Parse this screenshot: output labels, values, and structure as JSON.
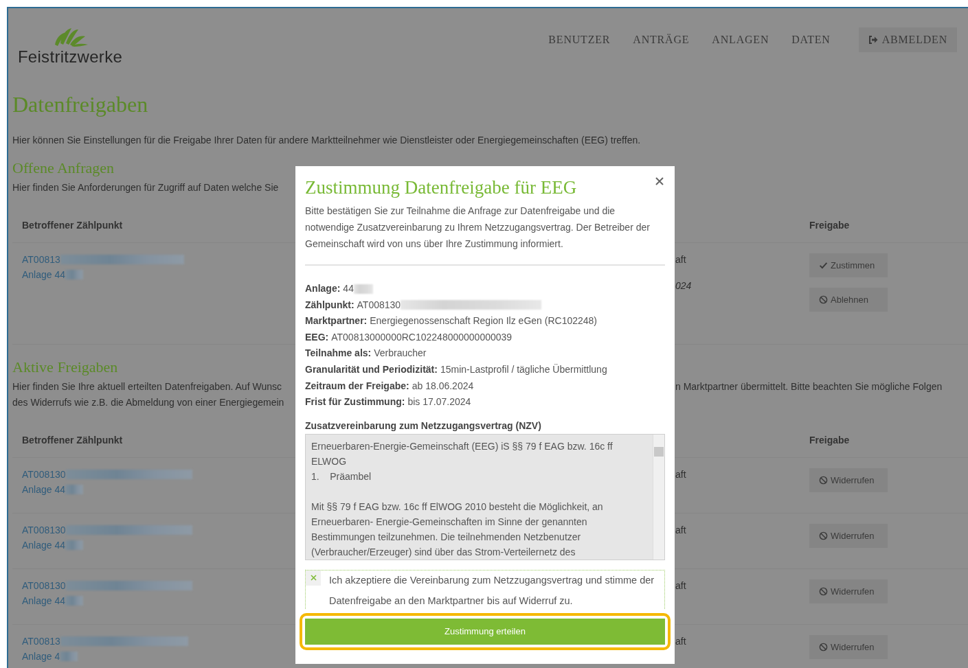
{
  "header": {
    "logo_text": "Feistritzwerke",
    "nav": [
      "BENUTZER",
      "ANTRÄGE",
      "ANLAGEN",
      "DATEN"
    ],
    "logout": "ABMELDEN"
  },
  "page": {
    "title": "Datenfreigaben",
    "description": "Hier können Sie Einstellungen für die Freigabe Ihrer Daten für andere Marktteilnehmer wie Dienstleister oder Energiegemeinschaften (EEG) treffen."
  },
  "open_requests": {
    "heading": "Offene Anfragen",
    "intro_left": [
      "Hier finden Sie Anforderungen für Zugriff auf Daten welche Sie"
    ],
    "columns": [
      "Betroffener Zählpunkt",
      "Freigabe"
    ],
    "rows": [
      {
        "meter": "AT00813",
        "plant": "Anlage 44",
        "fragments": [
          {
            "text": "aft",
            "italic": false
          },
          {
            "text": "024",
            "italic": true
          }
        ],
        "actions": [
          {
            "kind": "approve",
            "label": "Zustimmen"
          },
          {
            "kind": "reject",
            "label": "Ablehnen"
          }
        ]
      }
    ]
  },
  "active_releases": {
    "heading": "Aktive Freigaben",
    "intro_left": [
      "Hier finden Sie Ihre aktuell erteilten Datenfreigaben. Auf Wunsc",
      "des Widerrufs wie z.B. die Abmeldung von einer Energiegemein"
    ],
    "intro_right": [
      "n Marktpartner übermittelt. Bitte beachten Sie mögliche Folgen"
    ],
    "columns": [
      "Betroffener Zählpunkt",
      "Freigabe"
    ],
    "rows": [
      {
        "meter": "AT008130",
        "plant": "Anlage 44",
        "fragments": [
          {
            "text": "aft",
            "italic": false
          }
        ],
        "actions": [
          {
            "kind": "revoke",
            "label": "Widerrufen"
          }
        ]
      },
      {
        "meter": "AT008130",
        "plant": "Anlage 44",
        "fragments": [
          {
            "text": "aft",
            "italic": false
          }
        ],
        "actions": [
          {
            "kind": "revoke",
            "label": "Widerrufen"
          }
        ]
      },
      {
        "meter": "AT008130",
        "plant": "Anlage 44",
        "fragments": [
          {
            "text": "aft",
            "italic": false
          }
        ],
        "actions": [
          {
            "kind": "revoke",
            "label": "Widerrufen"
          }
        ]
      },
      {
        "meter": "AT00813",
        "plant": "Anlage 4",
        "fragments": [
          {
            "text": "aft",
            "italic": false
          }
        ],
        "actions": [
          {
            "kind": "revoke",
            "label": "Widerrufen"
          }
        ]
      }
    ]
  },
  "dialog": {
    "title": "Zustimmung Datenfreigabe für EEG",
    "intro": "Bitte bestätigen Sie zur Teilnahme die Anfrage zur Datenfreigabe und die notwendige Zusatzvereinbarung zu Ihrem Netzzugangsvertrag. Der Betreiber der Gemeinschaft wird von uns über Ihre Zustimmung informiert.",
    "details": [
      {
        "label": "Anlage:",
        "value": "44",
        "redacted": true
      },
      {
        "label": "Zählpunkt:",
        "value": "AT008130",
        "redacted": true
      },
      {
        "label": "Marktpartner:",
        "value": "Energiegenossenschaft Region Ilz eGen (RC102248)",
        "redacted": false
      },
      {
        "label": "EEG:",
        "value": "AT00813000000RC102248000000000039",
        "redacted": false
      },
      {
        "label": "Teilnahme als:",
        "value": "Verbraucher",
        "redacted": false
      },
      {
        "label": "Granularität und Periodizität:",
        "value": "15min-Lastprofil / tägliche Übermittlung",
        "redacted": false
      },
      {
        "label": "Zeitraum der Freigabe:",
        "value": "ab 18.06.2024",
        "redacted": false
      },
      {
        "label": "Frist für Zustimmung:",
        "value": "bis 17.07.2024",
        "redacted": false
      }
    ],
    "agreement_heading": "Zusatzvereinbarung zum Netzzugangsvertrag (NZV)",
    "agreement_text": [
      "Erneuerbaren-Energie-Gemeinschaft (EEG) iS §§ 79 f EAG bzw. 16c ff ELWOG",
      "1.    Präambel",
      "Mit §§ 79 f EAG bzw. 16c ff ElWOG 2010 besteht die Möglichkeit, an Erneuerbaren- Energie-Gemeinschaften im Sinne der genannten Bestimmungen teilzunehmen. Die teilnehmenden Netzbenutzer (Verbraucher/Erzeuger) sind über das Strom-Verteilernetz des"
    ],
    "consent": {
      "label": "Ich akzeptiere die Vereinbarung zum Netzzugangsvertrag und stimme der Datenfreigabe an den Marktpartner bis auf Widerruf zu.",
      "checked": true
    },
    "submit": "Zustimmung erteilen"
  }
}
